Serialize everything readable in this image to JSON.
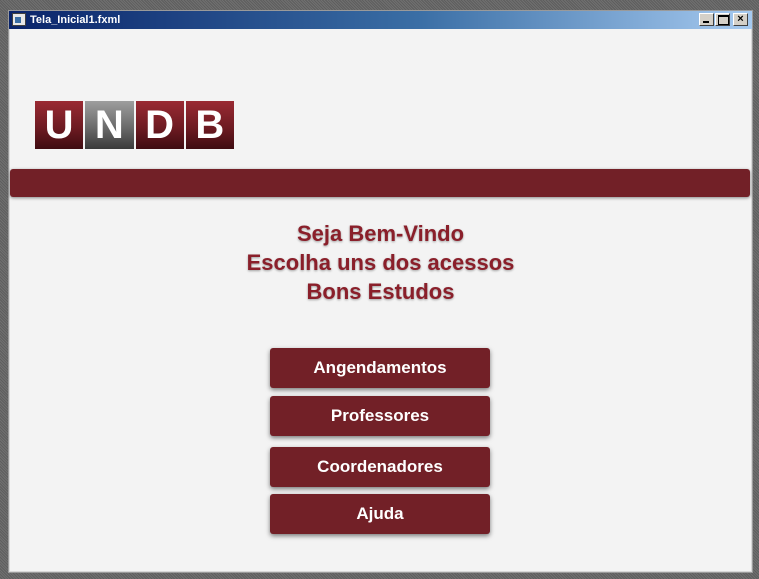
{
  "window": {
    "title": "Tela_Inicial1.fxml",
    "controls": {
      "minimize": "minimize-icon",
      "maximize": "maximize-icon",
      "close": "×"
    }
  },
  "logo": {
    "letters": [
      "U",
      "N",
      "D",
      "B"
    ]
  },
  "welcome": {
    "line1": "Seja Bem-Vindo",
    "line2": "Escolha uns dos acessos",
    "line3": "Bons Estudos"
  },
  "menu": {
    "buttons": [
      {
        "label": "Angendamentos"
      },
      {
        "label": "Professores"
      },
      {
        "label": "Coordenadores"
      },
      {
        "label": "Ajuda"
      }
    ]
  },
  "colors": {
    "brand": "#722027",
    "text_accent": "#8a1f2a",
    "background": "#f3f3f3"
  }
}
